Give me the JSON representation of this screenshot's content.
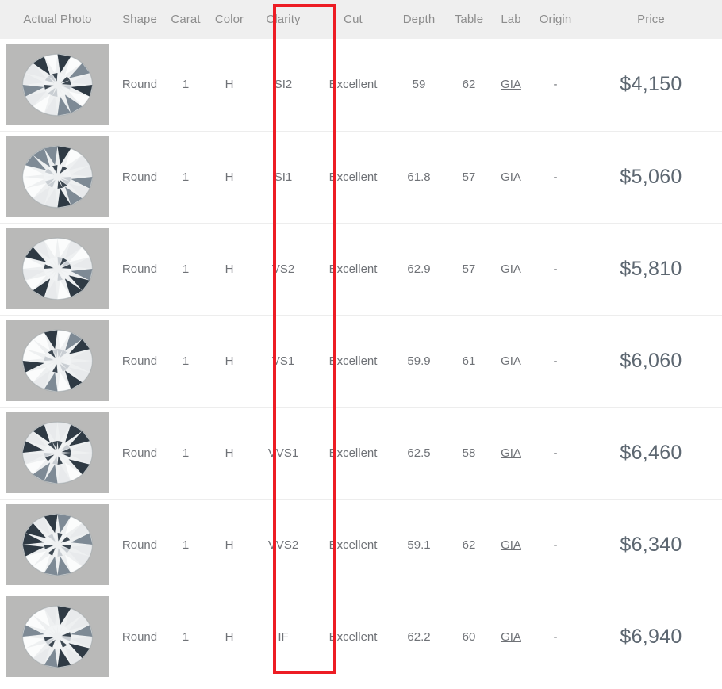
{
  "table": {
    "columns": [
      {
        "key": "photo",
        "label": "Actual Photo"
      },
      {
        "key": "shape",
        "label": "Shape"
      },
      {
        "key": "carat",
        "label": "Carat"
      },
      {
        "key": "color",
        "label": "Color"
      },
      {
        "key": "clarity",
        "label": "Clarity"
      },
      {
        "key": "cut",
        "label": "Cut"
      },
      {
        "key": "depth",
        "label": "Depth"
      },
      {
        "key": "table",
        "label": "Table"
      },
      {
        "key": "lab",
        "label": "Lab"
      },
      {
        "key": "origin",
        "label": "Origin"
      },
      {
        "key": "price",
        "label": "Price"
      }
    ],
    "rows": [
      {
        "photo_alt": "round-brilliant-diamond-photo",
        "shape": "Round",
        "carat": "1",
        "color": "H",
        "clarity": "SI2",
        "cut": "Excellent",
        "depth": "59",
        "table": "62",
        "lab": "GIA",
        "origin": "-",
        "price": "$4,150"
      },
      {
        "photo_alt": "round-brilliant-diamond-photo",
        "shape": "Round",
        "carat": "1",
        "color": "H",
        "clarity": "SI1",
        "cut": "Excellent",
        "depth": "61.8",
        "table": "57",
        "lab": "GIA",
        "origin": "-",
        "price": "$5,060"
      },
      {
        "photo_alt": "round-brilliant-diamond-photo",
        "shape": "Round",
        "carat": "1",
        "color": "H",
        "clarity": "VS2",
        "cut": "Excellent",
        "depth": "62.9",
        "table": "57",
        "lab": "GIA",
        "origin": "-",
        "price": "$5,810"
      },
      {
        "photo_alt": "round-brilliant-diamond-photo",
        "shape": "Round",
        "carat": "1",
        "color": "H",
        "clarity": "VS1",
        "cut": "Excellent",
        "depth": "59.9",
        "table": "61",
        "lab": "GIA",
        "origin": "-",
        "price": "$6,060"
      },
      {
        "photo_alt": "round-brilliant-diamond-photo",
        "shape": "Round",
        "carat": "1",
        "color": "H",
        "clarity": "VVS1",
        "cut": "Excellent",
        "depth": "62.5",
        "table": "58",
        "lab": "GIA",
        "origin": "-",
        "price": "$6,460"
      },
      {
        "photo_alt": "round-brilliant-diamond-photo",
        "shape": "Round",
        "carat": "1",
        "color": "H",
        "clarity": "VVS2",
        "cut": "Excellent",
        "depth": "59.1",
        "table": "62",
        "lab": "GIA",
        "origin": "-",
        "price": "$6,340"
      },
      {
        "photo_alt": "round-brilliant-diamond-photo",
        "shape": "Round",
        "carat": "1",
        "color": "H",
        "clarity": "IF",
        "cut": "Excellent",
        "depth": "62.2",
        "table": "60",
        "lab": "GIA",
        "origin": "-",
        "price": "$6,940"
      }
    ]
  },
  "annotation": {
    "highlight_column": "Clarity",
    "highlight_color": "#ed1c24"
  },
  "colors": {
    "header_background": "#efefef",
    "header_text": "#8d8d8d",
    "cell_text": "#6f7277",
    "price_text": "#5d6771",
    "row_divider": "#ededed",
    "thumb_background": "#b9b9b8"
  }
}
